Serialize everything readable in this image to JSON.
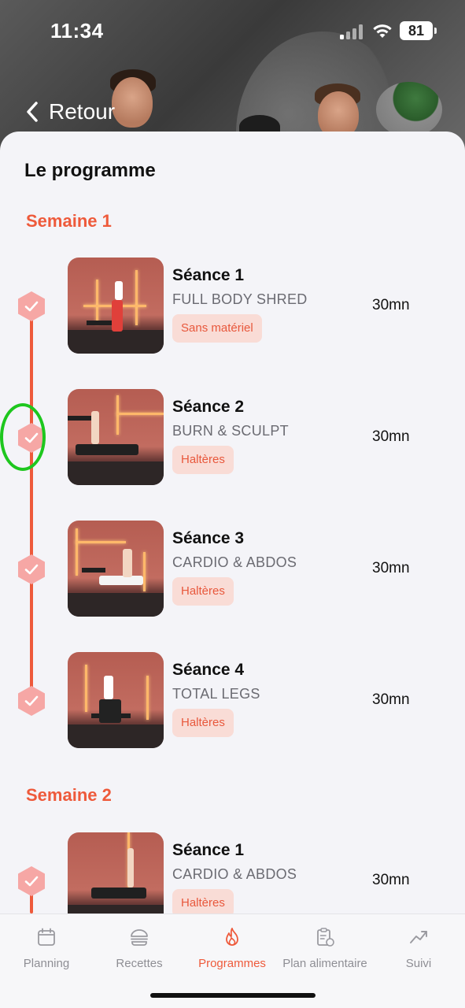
{
  "status_bar": {
    "time": "11:34",
    "battery": "81"
  },
  "header": {
    "back_label": "Retour"
  },
  "page_title": "Le programme",
  "colors": {
    "accent": "#ee5a3b",
    "tag_bg": "#f9dcd6",
    "highlight": "#1ec71e"
  },
  "weeks": [
    {
      "title": "Semaine 1",
      "sessions": [
        {
          "title": "Séance 1",
          "subtitle": "FULL BODY SHRED",
          "tag": "Sans matériel",
          "duration": "30mn",
          "completed": true
        },
        {
          "title": "Séance 2",
          "subtitle": "BURN & SCULPT",
          "tag": "Haltères",
          "duration": "30mn",
          "completed": true
        },
        {
          "title": "Séance 3",
          "subtitle": "CARDIO & ABDOS",
          "tag": "Haltères",
          "duration": "30mn",
          "completed": true
        },
        {
          "title": "Séance 4",
          "subtitle": "TOTAL LEGS",
          "tag": "Haltères",
          "duration": "30mn",
          "completed": true
        }
      ]
    },
    {
      "title": "Semaine 2",
      "sessions": [
        {
          "title": "Séance 1",
          "subtitle": "CARDIO & ABDOS",
          "tag": "Haltères",
          "duration": "30mn",
          "completed": true
        }
      ]
    }
  ],
  "tabbar": {
    "active": "Programmes",
    "items": [
      {
        "label": "Planning",
        "icon": "calendar-icon"
      },
      {
        "label": "Recettes",
        "icon": "burger-icon"
      },
      {
        "label": "Programmes",
        "icon": "flame-icon"
      },
      {
        "label": "Plan alimentaire",
        "icon": "clipboard-apple-icon"
      },
      {
        "label": "Suivi",
        "icon": "trend-icon"
      }
    ]
  }
}
